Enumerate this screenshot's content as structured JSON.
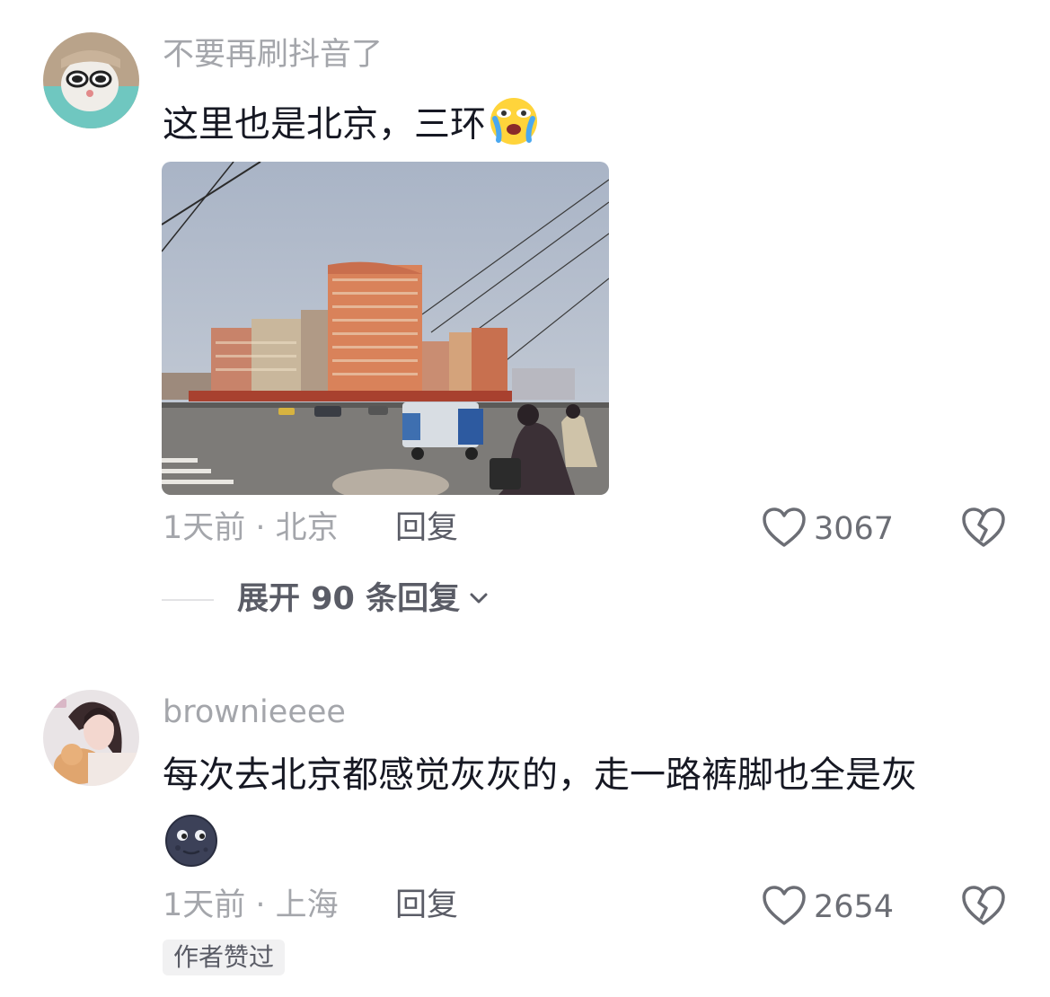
{
  "comments": [
    {
      "username": "不要再刷抖音了",
      "text": "这里也是北京，三环",
      "emoji": "loudly-crying-face",
      "time_location": "1天前 · 北京",
      "reply_label": "回复",
      "likes": "3067",
      "expand_label": "展开 90 条回复"
    },
    {
      "username": "brownieeee",
      "text_line1": "每次去北京都感觉灰灰的，走一路裤脚也全是灰",
      "emoji": "new-moon-face",
      "time_location": "1天前 · 上海",
      "reply_label": "回复",
      "likes": "2654",
      "badge": "作者赞过"
    }
  ],
  "colors": {
    "secondary_text": "#a4a6ab",
    "primary_text": "#161823",
    "action_text": "#5a5c66"
  }
}
